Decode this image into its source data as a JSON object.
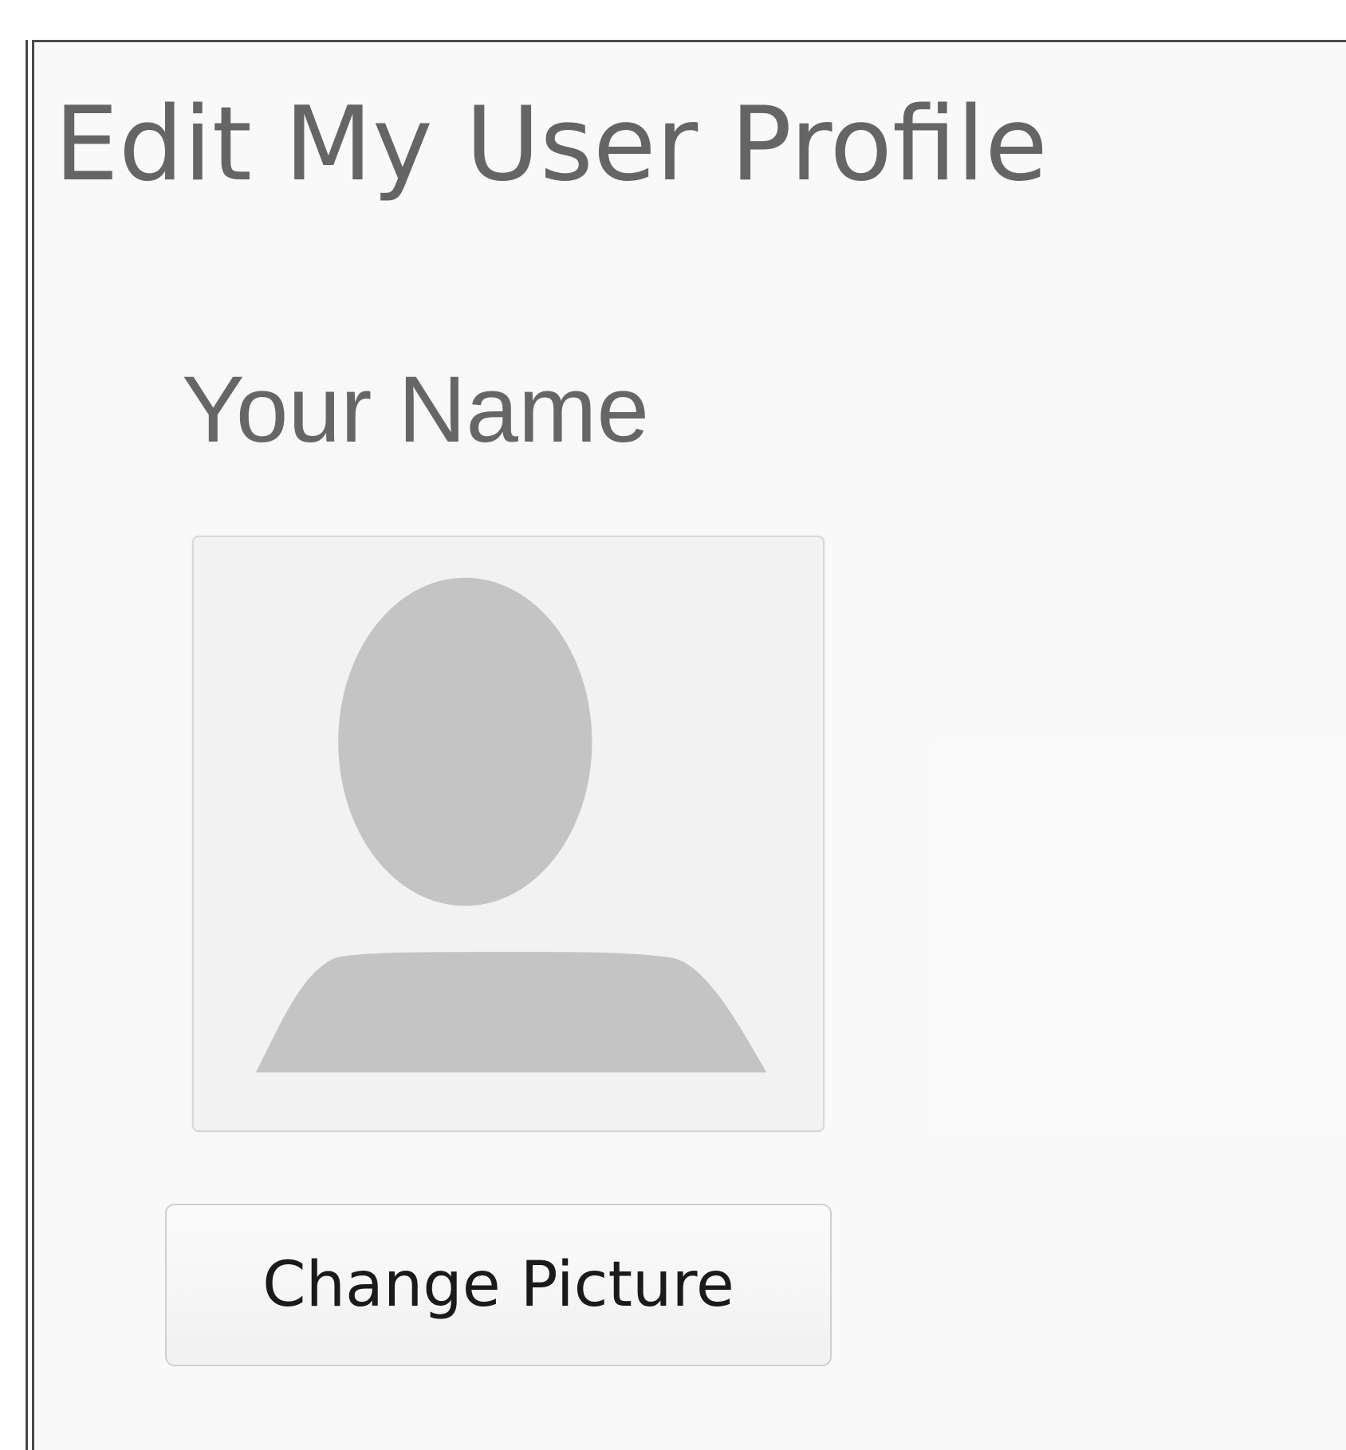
{
  "page": {
    "title": "Edit My User Profile"
  },
  "profile": {
    "name": "Your Name",
    "avatar_icon": "default-user-silhouette-icon",
    "change_picture_label": "Change Picture"
  },
  "colors": {
    "title_text": "#656565",
    "frame_border": "#4a4a4a",
    "background": "#f9f9f9",
    "avatar_background": "#f2f2f2",
    "silhouette": "#c4c4c4"
  }
}
